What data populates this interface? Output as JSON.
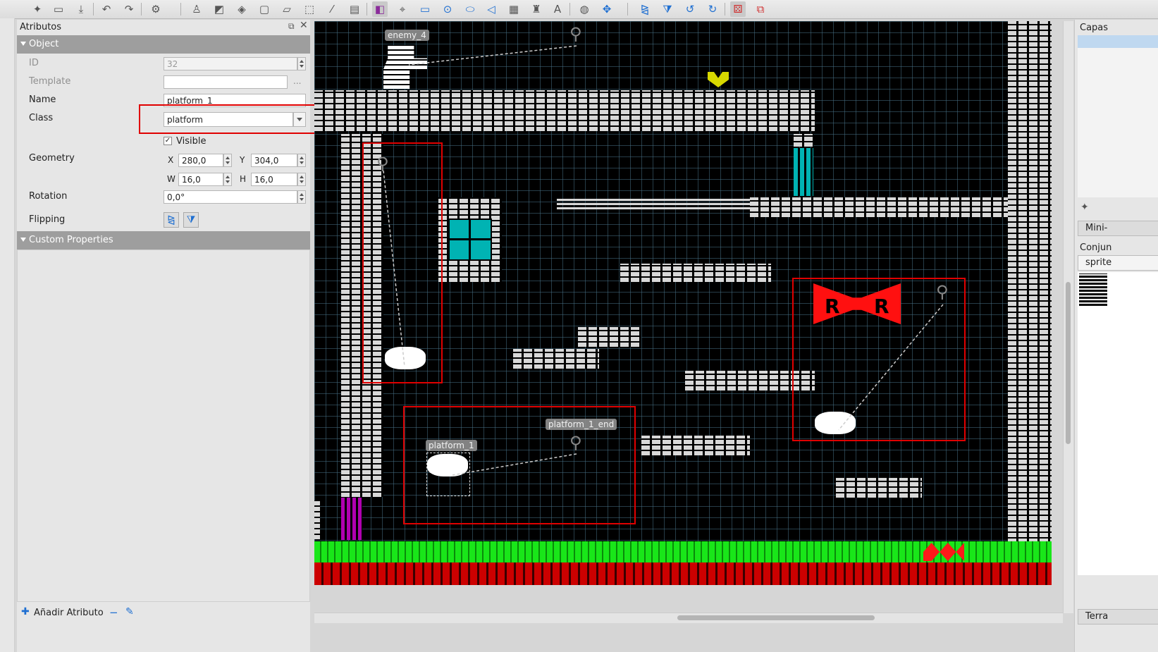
{
  "toolbar": {
    "icons": [
      "new-map-icon",
      "open-icon",
      "save-icon",
      "undo-icon",
      "redo-icon",
      "settings-icon",
      "stamp-icon",
      "terrain-brush-icon",
      "fill-icon",
      "shape-fill-icon",
      "eraser-icon",
      "rect-select-icon",
      "magic-wand-icon",
      "select-same-icon",
      "select-objects-icon",
      "edit-polygons-icon",
      "insert-rectangle-icon",
      "insert-point-icon",
      "insert-ellipse-icon",
      "insert-polygon-icon",
      "insert-tile-icon",
      "insert-template-icon",
      "insert-text-icon",
      "world-tool-icon",
      "move-icon",
      "flip-horizontal-icon",
      "flip-vertical-icon",
      "rotate-left-icon",
      "rotate-right-icon",
      "random-mode-icon",
      "wang-fill-icon"
    ]
  },
  "properties": {
    "title": "Atributos",
    "object_section": "Object",
    "id_label": "ID",
    "id_value": "32",
    "template_label": "Template",
    "template_value": "",
    "template_button": "...",
    "name_label": "Name",
    "name_value": "platform_1",
    "class_label": "Class",
    "class_value": "platform",
    "visible_label": "Visible",
    "geometry_label": "Geometry",
    "x_label": "X",
    "x_value": "280,0",
    "y_label": "Y",
    "y_value": "304,0",
    "w_label": "W",
    "w_value": "16,0",
    "h_label": "H",
    "h_value": "16,0",
    "rotation_label": "Rotation",
    "rotation_value": "0,0°",
    "flipping_label": "Flipping",
    "custom_section": "Custom Properties",
    "add_button": "Añadir Atributo",
    "remove_button": "−",
    "edit_button": "✎"
  },
  "map": {
    "labels": {
      "enemy": "enemy_4",
      "platform": "platform_1",
      "platform_end": "platform_1_end"
    }
  },
  "right_panel": {
    "layers_title": "Capas",
    "minimap_tab": "Mini-",
    "tilesets_title": "Conjun",
    "tileset_tab": "sprite",
    "terrain_tab": "Terra"
  },
  "colors": {
    "highlight_box": "#e00000",
    "ground_green": "#19e619",
    "ground_red": "#cc0000",
    "cyan_tile": "#00b3b3",
    "magenta_tile": "#b000b0"
  }
}
